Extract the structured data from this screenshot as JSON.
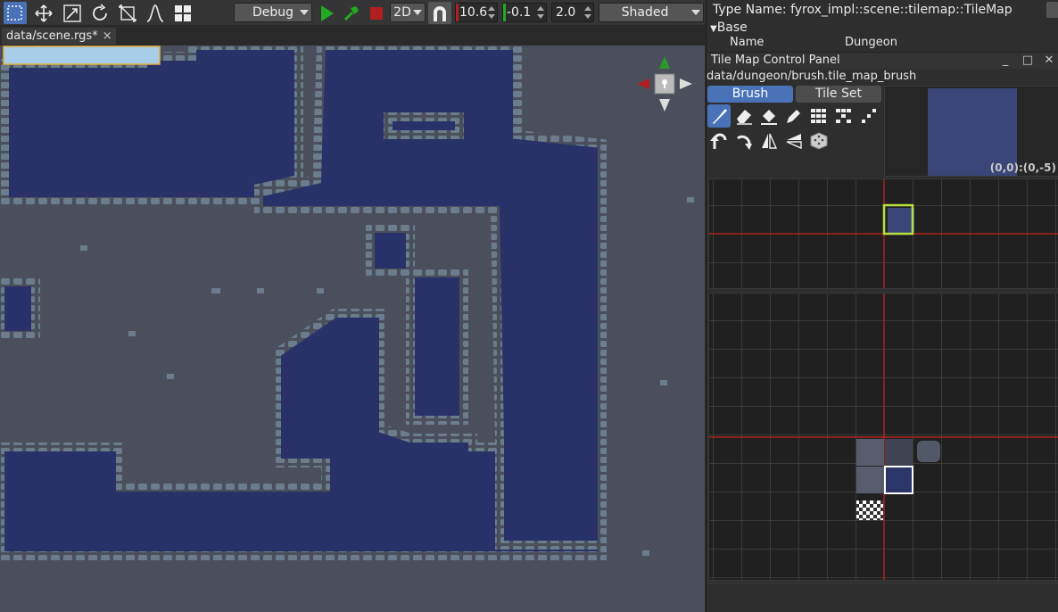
{
  "toolbar": {
    "tools": [
      {
        "name": "select-tool",
        "active": true
      },
      {
        "name": "move-tool",
        "active": false
      },
      {
        "name": "scale-tool",
        "active": false
      },
      {
        "name": "rotate-tool",
        "active": false
      },
      {
        "name": "crop-tool",
        "active": false
      },
      {
        "name": "curve-tool",
        "active": false
      },
      {
        "name": "grid-tool",
        "active": false
      }
    ],
    "build_config": "Debug",
    "mode": "2D",
    "num1": "10.6",
    "num2": "-0.1",
    "num3": "2.0",
    "render_mode": "Shaded",
    "colors": {
      "play": "#22aa22",
      "stop": "#b02020",
      "accent": "#4a72b8"
    }
  },
  "scene_tab": {
    "label": "data/scene.rgs*",
    "close": "×"
  },
  "inspector": {
    "type_name": "Type Name: fyrox_impl::scene::tilemap::TileMap",
    "section": "Base",
    "section_expander": "▼",
    "name_label": "Name",
    "name_value": "Dungeon"
  },
  "tile_map_panel": {
    "title": "Tile Map Control Panel",
    "minimize": "_",
    "maximize": "□",
    "close": "✕",
    "brush_path": "data/dungeon/brush.tile_map_brush",
    "tabs": [
      "Brush",
      "Tile Set"
    ],
    "active_tab": "Brush",
    "tools_row1": [
      "paint-brush-icon",
      "eraser-icon",
      "flood-fill-icon",
      "picker-icon",
      "rect-fill-icon",
      "nine-slice-icon",
      "line-icon"
    ],
    "tools_row2": [
      "rotate-left-icon",
      "rotate-right-icon",
      "flip-x-icon",
      "flip-y-icon",
      "random-icon"
    ],
    "preview_coords": "(0,0):(0,-5)",
    "colors": {
      "axis": "#d02020",
      "selection": "#b8e040",
      "tile": "#3b4678"
    }
  }
}
